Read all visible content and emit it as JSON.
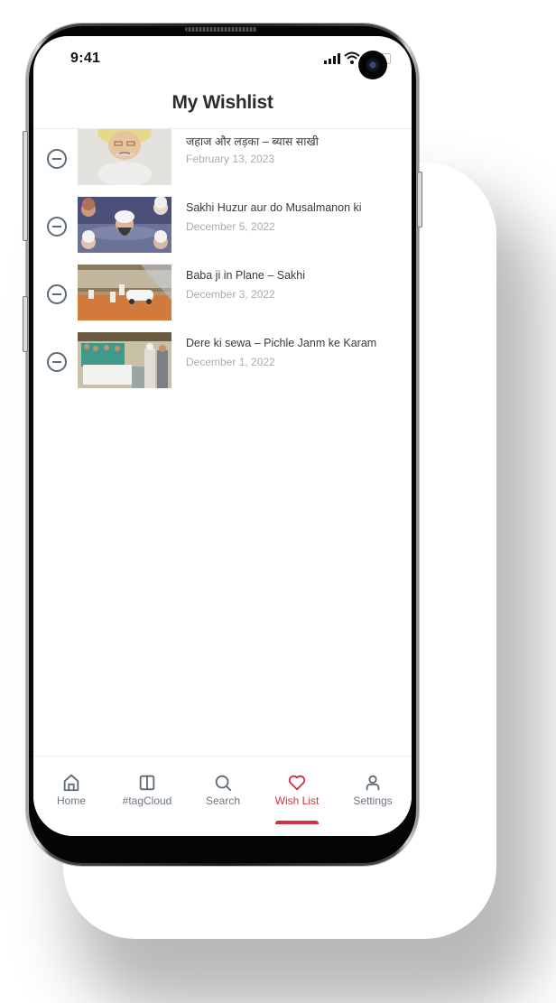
{
  "status_bar": {
    "time": "9:41",
    "icons": [
      "signal-icon",
      "wifi-icon",
      "battery-icon"
    ]
  },
  "header": {
    "title": "My Wishlist"
  },
  "wishlist": {
    "items": [
      {
        "title": "जहाज और लड़का – ब्यास साखी",
        "date": "February 13, 2023",
        "thumbnail": "portrait-turban-painting",
        "remove_icon": "minus-circle-icon"
      },
      {
        "title": "Sakhi Huzur aur do Musalmanon ki",
        "date": "December 5, 2022",
        "thumbnail": "collage-of-elders",
        "remove_icon": "minus-circle-icon"
      },
      {
        "title": "Baba ji in Plane – Sakhi",
        "date": "December 3, 2022",
        "thumbnail": "crowd-with-white-car",
        "remove_icon": "minus-circle-icon"
      },
      {
        "title": "Dere ki sewa – Pichle Janm ke Karam",
        "date": "December 1, 2022",
        "thumbnail": "sewa-hall-gathering",
        "remove_icon": "minus-circle-icon"
      }
    ]
  },
  "bottom_nav": {
    "items": [
      {
        "label": "Home",
        "icon": "home-icon",
        "active": false
      },
      {
        "label": "#tagCloud",
        "icon": "columns-icon",
        "active": false
      },
      {
        "label": "Search",
        "icon": "search-icon",
        "active": false
      },
      {
        "label": "Wish List",
        "icon": "heart-icon",
        "active": true
      },
      {
        "label": "Settings",
        "icon": "user-icon",
        "active": false
      }
    ]
  },
  "colors": {
    "accent": "#d0323f",
    "icon_gray": "#5c6b78",
    "date_gray": "#a8adb2",
    "title_dark": "#2d2d2d"
  }
}
